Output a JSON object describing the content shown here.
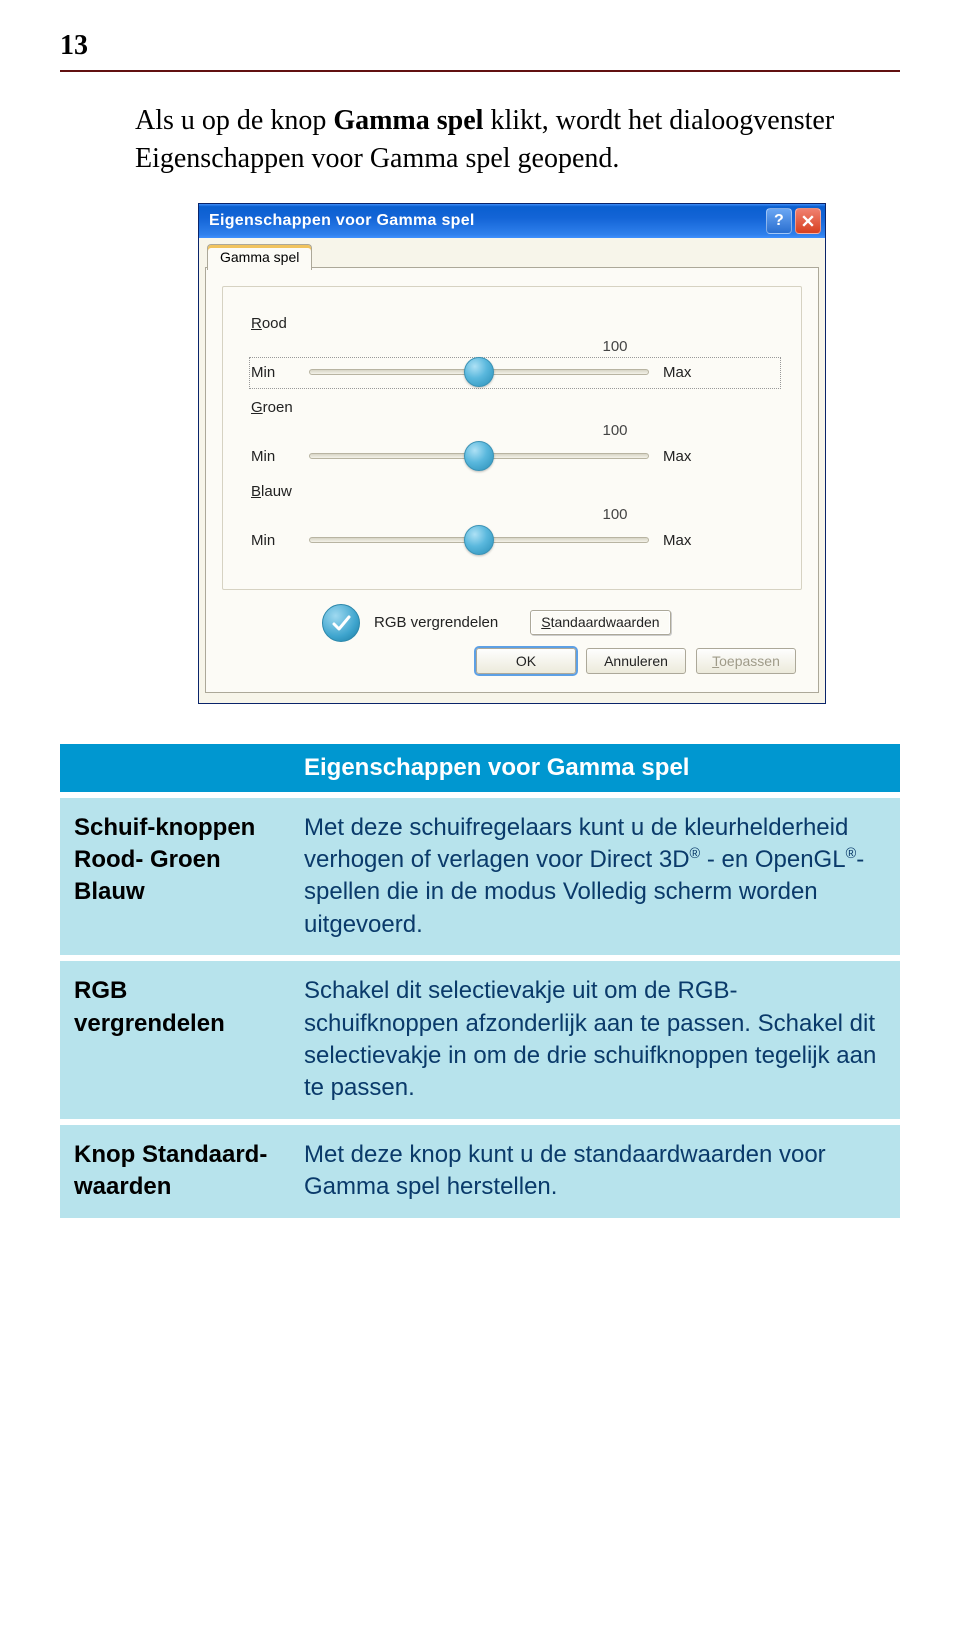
{
  "page_number": "13",
  "intro": {
    "prefix": "Als u op de knop ",
    "bold": "Gamma spel",
    "suffix": " klikt, wordt het dialoogvenster Eigenschappen voor Gamma spel geopend."
  },
  "dialog": {
    "title": "Eigenschappen voor Gamma spel",
    "tab": "Gamma spel",
    "sliders": [
      {
        "name_u": "R",
        "name_rest": "ood",
        "value": "100",
        "min": "Min",
        "max": "Max"
      },
      {
        "name_u": "G",
        "name_rest": "roen",
        "value": "100",
        "min": "Min",
        "max": "Max"
      },
      {
        "name_u": "B",
        "name_rest": "lauw",
        "value": "100",
        "min": "Min",
        "max": "Max"
      }
    ],
    "lock_label": "RGB vergrendelen",
    "defaults_u": "S",
    "defaults_rest": "tandaardwaarden",
    "buttons": {
      "ok": "OK",
      "cancel": "Annuleren",
      "apply_u": "T",
      "apply_rest": "oepassen"
    }
  },
  "table": {
    "header": "Eigenschappen voor Gamma spel",
    "rows": [
      {
        "label": "Schuif-knoppen Rood- Groen Blauw",
        "desc": "Met deze schuifregelaars kunt u de kleurhelderheid verhogen of verlagen voor Direct 3D® - en OpenGL®-spellen die in de modus Volledig scherm worden uitgevoerd."
      },
      {
        "label": "RGB vergrendelen",
        "desc": "Schakel dit selectievakje uit om de RGB-schuifknoppen afzonderlijk aan te passen. Schakel dit selectievakje in om de drie schuifknoppen tegelijk aan te passen."
      },
      {
        "label": "Knop Standaard-waarden",
        "desc": "Met deze knop kunt u de standaardwaarden voor Gamma spel herstellen."
      }
    ]
  }
}
